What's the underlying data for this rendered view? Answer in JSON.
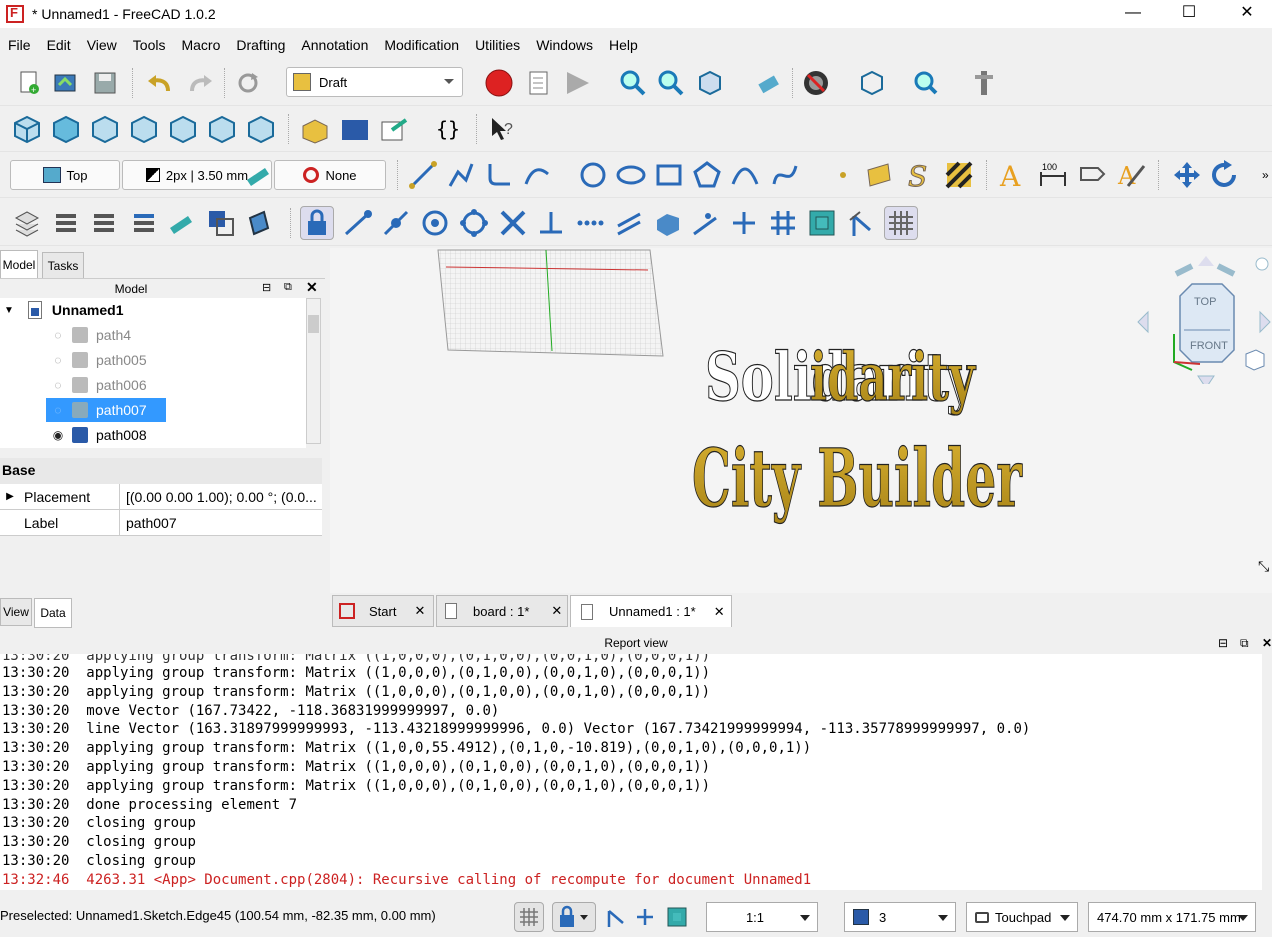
{
  "window": {
    "title": "* Unnamed1 - FreeCAD 1.0.2",
    "minimize": "—",
    "maximize": "☐",
    "close": "✕"
  },
  "menu": [
    "File",
    "Edit",
    "View",
    "Tools",
    "Macro",
    "Drafting",
    "Annotation",
    "Modification",
    "Utilities",
    "Windows",
    "Help"
  ],
  "toolbar1": {
    "workbench": "Draft"
  },
  "toolbar3": {
    "working_plane": "Top",
    "line_style": "2px | 3.50 mm",
    "snap_style": "None"
  },
  "left_panel": {
    "tabs": [
      "Model",
      "Tasks"
    ],
    "panel_title": "Model",
    "tree": [
      {
        "label": "Unnamed1",
        "type": "document",
        "visible": true
      },
      {
        "label": "path4",
        "visible": false,
        "selected": false
      },
      {
        "label": "path005",
        "visible": false,
        "selected": false
      },
      {
        "label": "path006",
        "visible": false,
        "selected": false
      },
      {
        "label": "path007",
        "visible": false,
        "selected": true
      },
      {
        "label": "path008",
        "visible": true,
        "selected": false
      }
    ],
    "property_group": "Base",
    "properties": [
      {
        "name": "Placement",
        "value": "[(0.00 0.00 1.00); 0.00 °; (0.0..."
      },
      {
        "name": "Label",
        "value": "path007"
      }
    ],
    "bottom_tabs": [
      "View",
      "Data"
    ]
  },
  "viewport": {
    "text_line1": "Solidarity",
    "text_line2": "City Builder",
    "navcube_top": "TOP",
    "navcube_front": "FRONT"
  },
  "doc_tabs": [
    {
      "label": "Start",
      "active": false
    },
    {
      "label": "board : 1*",
      "active": false
    },
    {
      "label": "Unnamed1 : 1*",
      "active": true
    }
  ],
  "report": {
    "title": "Report view",
    "lines": [
      {
        "time": "13:30:20",
        "text": "applying group transform: Matrix ((1,0,0,0),(0,1,0,0),(0,0,1,0),(0,0,0,1))",
        "error": false
      },
      {
        "time": "13:30:20",
        "text": "applying group transform: Matrix ((1,0,0,0),(0,1,0,0),(0,0,1,0),(0,0,0,1))",
        "error": false
      },
      {
        "time": "13:30:20",
        "text": "move Vector (167.73422, -118.36831999999997, 0.0)",
        "error": false
      },
      {
        "time": "13:30:20",
        "text": "line Vector (163.31897999999993, -113.43218999999996, 0.0) Vector (167.73421999999994, -113.35778999999997, 0.0)",
        "error": false
      },
      {
        "time": "13:30:20",
        "text": "applying group transform: Matrix ((1,0,0,55.4912),(0,1,0,-10.819),(0,0,1,0),(0,0,0,1))",
        "error": false
      },
      {
        "time": "13:30:20",
        "text": "applying group transform: Matrix ((1,0,0,0),(0,1,0,0),(0,0,1,0),(0,0,0,1))",
        "error": false
      },
      {
        "time": "13:30:20",
        "text": "applying group transform: Matrix ((1,0,0,0),(0,1,0,0),(0,0,1,0),(0,0,0,1))",
        "error": false
      },
      {
        "time": "13:30:20",
        "text": "done processing element 7",
        "error": false
      },
      {
        "time": "13:30:20",
        "text": "closing group",
        "error": false
      },
      {
        "time": "13:30:20",
        "text": "closing group",
        "error": false
      },
      {
        "time": "13:30:20",
        "text": "closing group",
        "error": false
      },
      {
        "time": "13:32:46",
        "text": "4263.31 <App> Document.cpp(2804): Recursive calling of recompute for document Unnamed1",
        "error": true
      }
    ]
  },
  "status": {
    "preselected": "Preselected: Unnamed1.Sketch.Edge45 (100.54 mm, -82.35 mm, 0.00 mm)",
    "scale": "1:1",
    "layer": "3",
    "nav_style": "Touchpad",
    "dimensions": "474.70 mm x 171.75 mm"
  },
  "colors": {
    "selection": "#3399ff",
    "error_text": "#cc2222",
    "text_gold": "#c8a020"
  }
}
